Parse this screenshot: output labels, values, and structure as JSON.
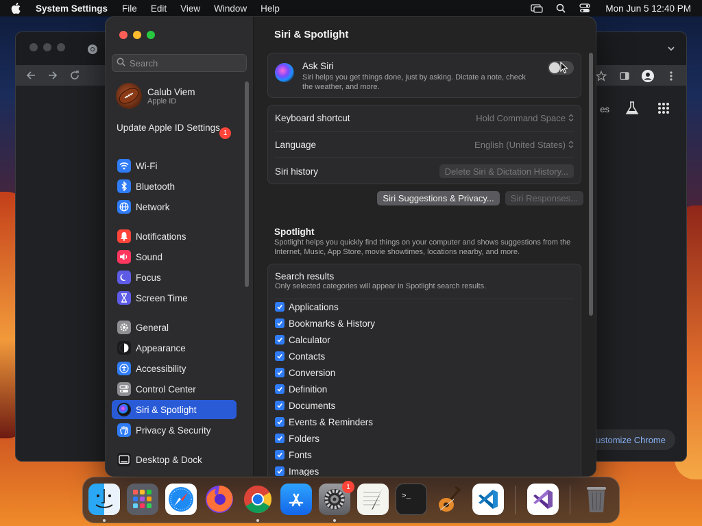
{
  "menubar": {
    "app_name": "System Settings",
    "menus": [
      "File",
      "Edit",
      "View",
      "Window",
      "Help"
    ],
    "clock": "Mon Jun 5  12:40 PM"
  },
  "chrome_bg": {
    "partial_text": "es",
    "customize_label": "ustomize Chrome"
  },
  "sidebar": {
    "search_placeholder": "Search",
    "profile": {
      "name": "Calub Viem",
      "subtitle": "Apple ID"
    },
    "update": {
      "label": "Update Apple ID Settings",
      "badge": "1"
    },
    "items": [
      {
        "label": "Wi-Fi",
        "icon": "wifi-icon",
        "color": "#2f7cf6"
      },
      {
        "label": "Bluetooth",
        "icon": "bluetooth-icon",
        "color": "#2f7cf6"
      },
      {
        "label": "Network",
        "icon": "globe-icon",
        "color": "#2f7cf6"
      },
      {
        "label": "Notifications",
        "icon": "bell-icon",
        "color": "#ff453a"
      },
      {
        "label": "Sound",
        "icon": "speaker-icon",
        "color": "#ff375f"
      },
      {
        "label": "Focus",
        "icon": "moon-icon",
        "color": "#5e5ce6"
      },
      {
        "label": "Screen Time",
        "icon": "hourglass-icon",
        "color": "#5e5ce6"
      },
      {
        "label": "General",
        "icon": "gear-icon",
        "color": "#8e8e93"
      },
      {
        "label": "Appearance",
        "icon": "appearance-icon",
        "color": "#1c1c1e"
      },
      {
        "label": "Accessibility",
        "icon": "accessibility-icon",
        "color": "#2f7cf6"
      },
      {
        "label": "Control Center",
        "icon": "control-center-icon",
        "color": "#8e8e93"
      },
      {
        "label": "Siri & Spotlight",
        "icon": "siri-icon",
        "color": "#1c1c1e",
        "active": true
      },
      {
        "label": "Privacy & Security",
        "icon": "hand-icon",
        "color": "#2f7cf6"
      },
      {
        "label": "Desktop & Dock",
        "icon": "desktop-icon",
        "color": "#1c1c1e"
      }
    ]
  },
  "main": {
    "title": "Siri & Spotlight",
    "ask_siri": {
      "title": "Ask Siri",
      "description": "Siri helps you get things done, just by asking. Dictate a note, check the weather, and more.",
      "enabled": false
    },
    "keyboard_shortcut": {
      "label": "Keyboard shortcut",
      "value": "Hold Command Space"
    },
    "language": {
      "label": "Language",
      "value": "English (United States)"
    },
    "siri_history": {
      "label": "Siri history",
      "button": "Delete Siri & Dictation History..."
    },
    "buttons": {
      "suggestions": "Siri Suggestions & Privacy...",
      "responses": "Siri Responses..."
    },
    "spotlight": {
      "title": "Spotlight",
      "description": "Spotlight helps you quickly find things on your computer and shows suggestions from the Internet, Music, App Store, movie showtimes, locations nearby, and more."
    },
    "search_results": {
      "title": "Search results",
      "subtitle": "Only selected categories will appear in Spotlight search results.",
      "items": [
        "Applications",
        "Bookmarks & History",
        "Calculator",
        "Contacts",
        "Conversion",
        "Definition",
        "Documents",
        "Events & Reminders",
        "Folders",
        "Fonts",
        "Images"
      ]
    }
  },
  "dock": {
    "apps": [
      {
        "name": "Finder",
        "icon": "finder-icon",
        "running": true
      },
      {
        "name": "Launchpad",
        "icon": "launchpad-icon"
      },
      {
        "name": "Safari",
        "icon": "safari-icon"
      },
      {
        "name": "Firefox",
        "icon": "firefox-icon"
      },
      {
        "name": "Chrome",
        "icon": "chrome-icon",
        "running": true
      },
      {
        "name": "App Store",
        "icon": "app-store-icon"
      },
      {
        "name": "System Settings",
        "icon": "settings-icon",
        "running": true,
        "badge": "1"
      },
      {
        "name": "TextEdit",
        "icon": "textedit-icon"
      },
      {
        "name": "Terminal",
        "icon": "terminal-icon"
      },
      {
        "name": "GarageBand",
        "icon": "garageband-icon"
      },
      {
        "name": "VS Code",
        "icon": "vscode-icon"
      },
      {
        "name": "Visual Studio",
        "icon": "visual-studio-icon"
      },
      {
        "name": "Trash",
        "icon": "trash-icon"
      }
    ]
  }
}
